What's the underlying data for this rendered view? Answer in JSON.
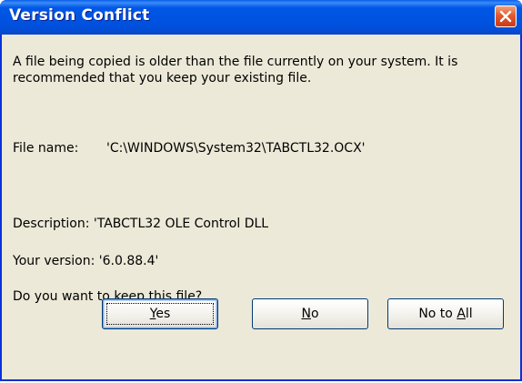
{
  "window": {
    "title": "Version Conflict"
  },
  "message": "A file being copied is older than the file currently on your system.  It is recommended that you keep your existing file.",
  "file": {
    "label": "File name:",
    "value": "'C:\\WINDOWS\\System32\\TABCTL32.OCX'"
  },
  "description": {
    "text": "Description:  'TABCTL32 OLE Control DLL"
  },
  "version": {
    "text": "Your version: '6.0.88.4'"
  },
  "question": "Do you want to keep this file?",
  "buttons": {
    "yes": {
      "pre": "",
      "mnemonic": "Y",
      "post": "es"
    },
    "no": {
      "pre": "",
      "mnemonic": "N",
      "post": "o"
    },
    "no_to_all": {
      "pre": "No to ",
      "mnemonic": "A",
      "post": "ll"
    }
  },
  "icons": {
    "close": "close-icon"
  },
  "colors": {
    "titlebar": "#0053e1",
    "window_bg": "#ece9d8",
    "close_button": "#e25a2c",
    "border": "#0831d9"
  }
}
